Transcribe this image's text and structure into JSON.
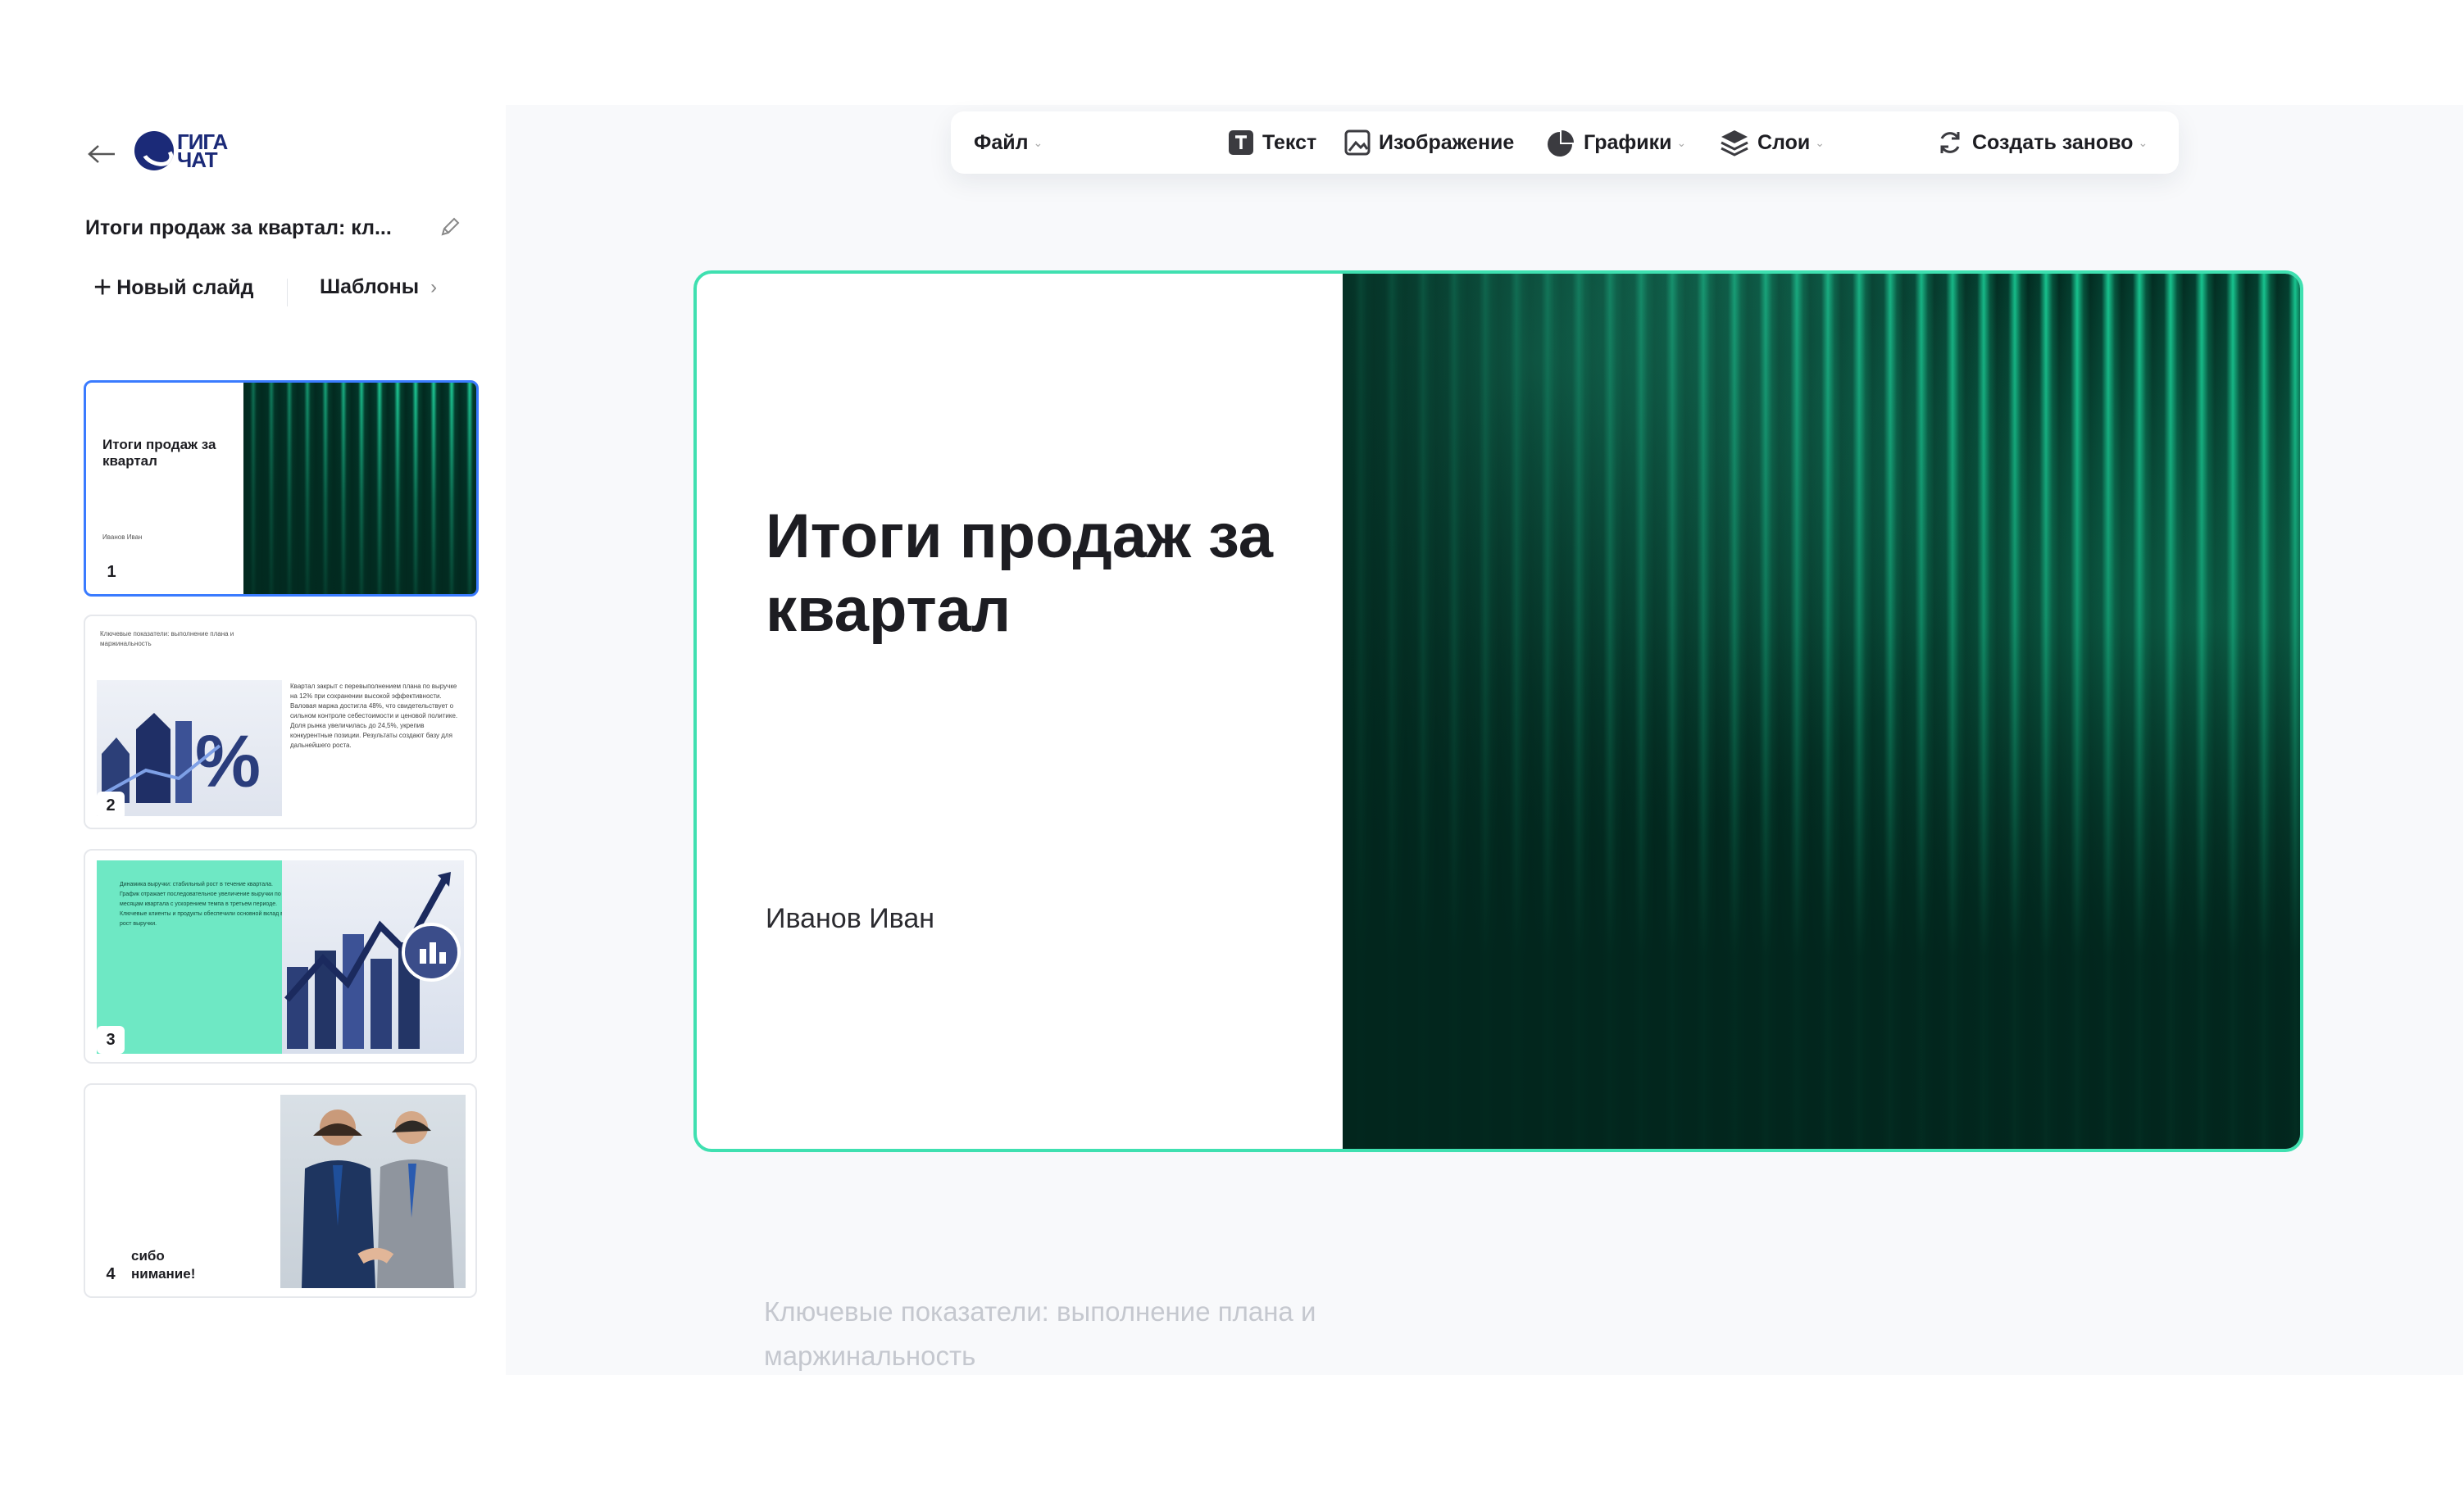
{
  "sidebar": {
    "logo_line1": "ГИГА",
    "logo_line2": "ЧАТ",
    "presentation_title": "Итоги продаж за квартал: кл...",
    "new_slide_label": "Новый слайд",
    "templates_label": "Шаблоны",
    "thumbnails": [
      {
        "number": "1",
        "title": "Итоги продаж за квартал",
        "author": "Иванов Иван"
      },
      {
        "number": "2",
        "heading": "Ключевые показатели: выполнение плана и маржинальность",
        "body": "Квартал закрыт с перевыполнением плана по выручке на 12% при сохранении высокой эффективности. Валовая маржа достигла 48%, что свидетельствует о сильном контроле себестоимости и ценовой политике. Доля рынка увеличилась до 24,5%, укрепив конкурентные позиции. Результаты создают базу для дальнейшего роста."
      },
      {
        "number": "3",
        "body": "Динамика выручки: стабильный рост в течение квартала. График отражает последовательное увеличение выручки по месяцам квартала с ускорением темпа в третьем периоде. Ключевые клиенты и продукты обеспечили основной вклад в рост выручки."
      },
      {
        "number": "4",
        "text": "сибо\nнимание!"
      }
    ]
  },
  "toolbar": {
    "file": "Файл",
    "text": "Текст",
    "image": "Изображение",
    "charts": "Графики",
    "layers": "Слои",
    "regenerate": "Создать заново"
  },
  "slide": {
    "title": "Итоги продаж за квартал",
    "author": "Иванов Иван"
  },
  "next_slide_preview": "Ключевые показатели: выполнение плана и маржинальность",
  "colors": {
    "accent": "#3fe0b0",
    "selection": "#3a7bff",
    "dark_green": "#02291f",
    "brand_blue": "#1b2a78"
  }
}
